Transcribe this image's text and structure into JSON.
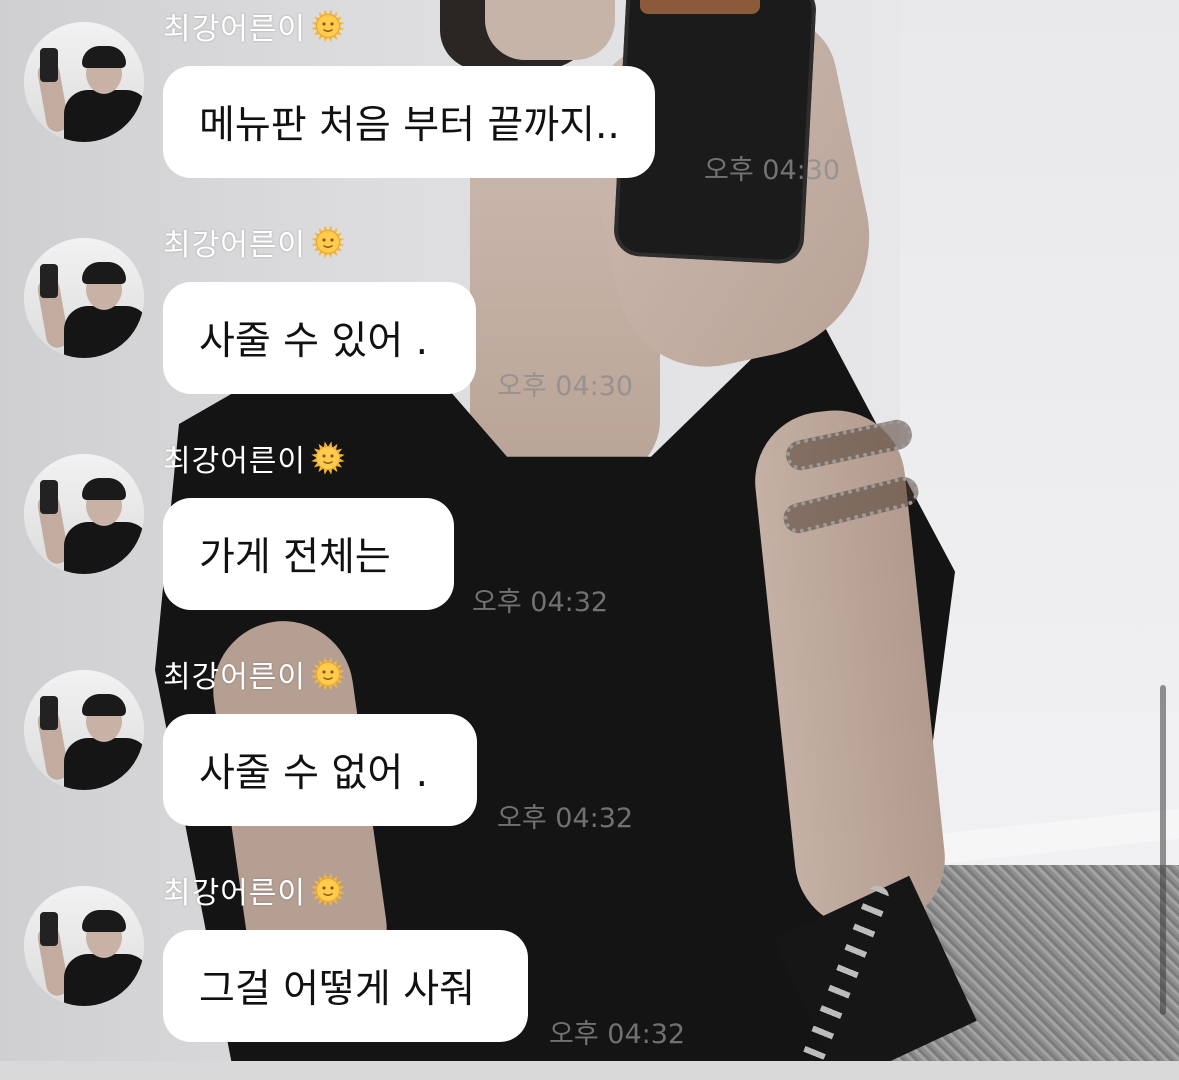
{
  "chat": {
    "messages": [
      {
        "sender": "최강어른이",
        "text": "메뉴판 처음 부터 끝까지..",
        "time": "오후 04:30"
      },
      {
        "sender": "최강어른이",
        "text": "사줄 수 있어 .",
        "time": "오후 04:30"
      },
      {
        "sender": "최강어른이",
        "text": "가게 전체는",
        "time": "오후 04:32"
      },
      {
        "sender": "최강어른이",
        "text": "사줄 수 없어 .",
        "time": "오후 04:32"
      },
      {
        "sender": "최강어른이",
        "text": "그걸 어떻게 사줘",
        "time": "오후 04:32"
      }
    ],
    "sender_badge_icon": "sun-with-face-icon",
    "colors": {
      "bubble": "#ffffff",
      "text": "#111111",
      "sender": "#ffffff",
      "time": "#8c8c8c"
    }
  }
}
